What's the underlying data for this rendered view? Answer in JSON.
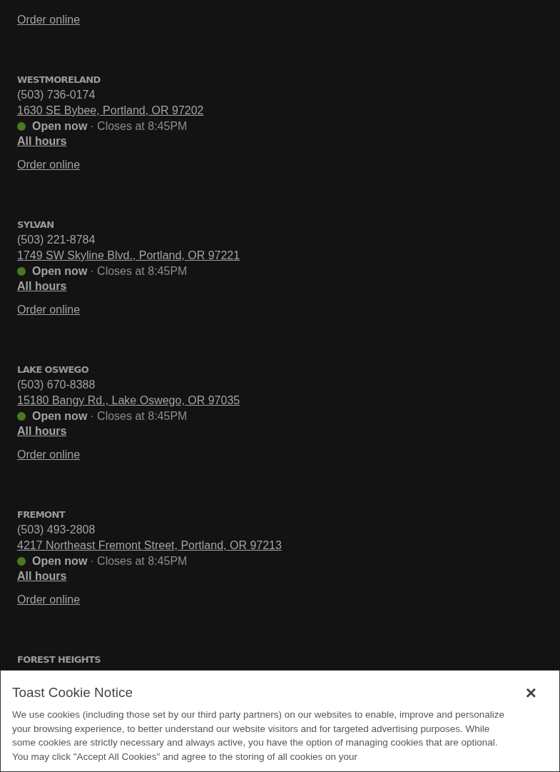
{
  "locations": [
    {
      "order_link": "Order online"
    },
    {
      "name": "WESTMORELAND",
      "phone": "(503) 736-0174",
      "address": "1630 SE Bybee, Portland, OR 97202",
      "open": true,
      "status": "Open now",
      "closes": "· Closes at 8:45PM",
      "hours_link": "All hours",
      "order_link": "Order online"
    },
    {
      "name": "SYLVAN",
      "phone": "(503) 221-8784",
      "address": "1749 SW Skyline Blvd., Portland, OR 97221",
      "open": true,
      "status": "Open now",
      "closes": "· Closes at 8:45PM",
      "hours_link": "All hours",
      "order_link": "Order online"
    },
    {
      "name": "LAKE OSWEGO",
      "phone": "(503) 670-8388",
      "address": "15180 Bangy Rd., Lake Oswego, OR 97035",
      "open": true,
      "status": "Open now",
      "closes": "· Closes at 8:45PM",
      "hours_link": "All hours",
      "order_link": "Order online"
    },
    {
      "name": "FREMONT",
      "phone": "(503) 493-2808",
      "address": "4217 Northeast Fremont Street, Portland, OR 97213",
      "open": true,
      "status": "Open now",
      "closes": "· Closes at 8:45PM",
      "hours_link": "All hours",
      "order_link": "Order online"
    },
    {
      "name": "FOREST HEIGHTS"
    }
  ],
  "cookie_notice": {
    "title": "Toast Cookie Notice",
    "close": "×",
    "text": "We use cookies (including those set by our third party partners) on our websites to enable, improve and personalize your browsing experience, to better understand our website visitors and for targeted advertising purposes. While some cookies are strictly necessary and always active, you have the option of managing cookies that are optional. You may click \"Accept All Cookies\" and agree to the storing of all cookies on your"
  }
}
